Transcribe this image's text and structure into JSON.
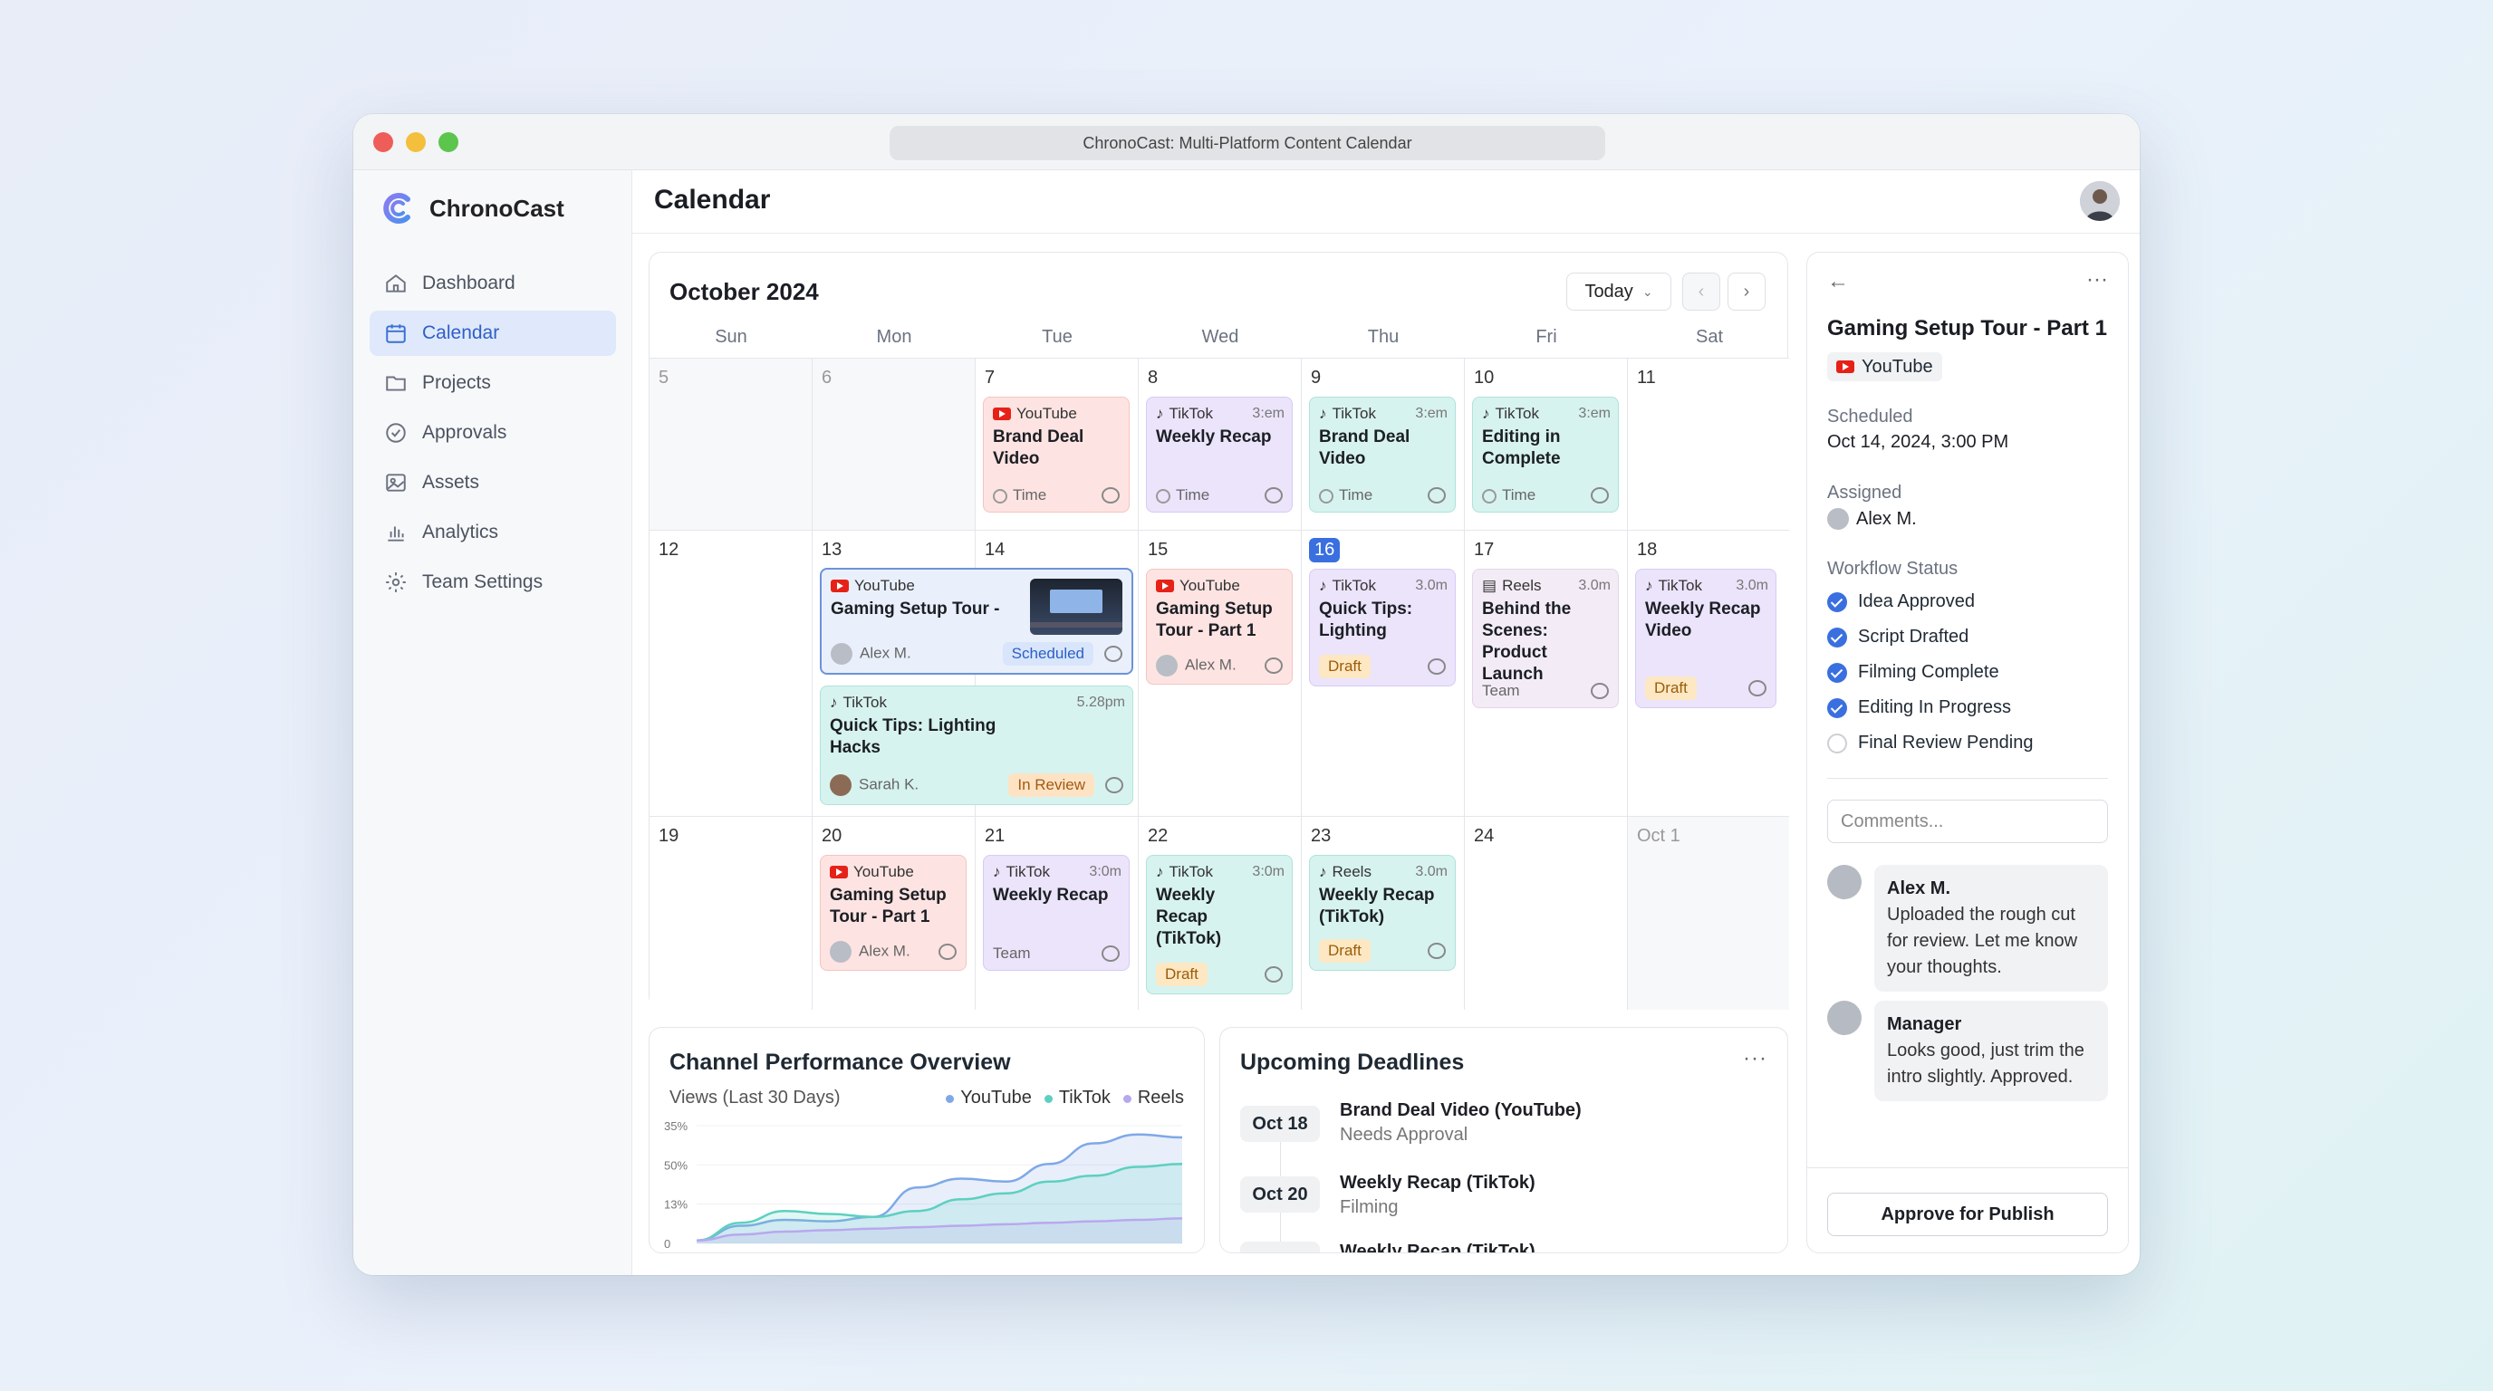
{
  "window": {
    "title": "ChronoCast: Multi-Platform Content Calendar"
  },
  "brand": {
    "name": "ChronoCast"
  },
  "sidebar": {
    "items": [
      {
        "label": "Dashboard",
        "icon": "home-icon"
      },
      {
        "label": "Calendar",
        "icon": "calendar-icon",
        "active": true
      },
      {
        "label": "Projects",
        "icon": "folder-icon"
      },
      {
        "label": "Approvals",
        "icon": "check-circle-icon"
      },
      {
        "label": "Assets",
        "icon": "image-icon"
      },
      {
        "label": "Analytics",
        "icon": "bar-chart-icon"
      },
      {
        "label": "Team Settings",
        "icon": "gear-icon"
      }
    ]
  },
  "header": {
    "title": "Calendar"
  },
  "calendar": {
    "month": "October 2024",
    "today_label": "Today",
    "weekdays": [
      "Sun",
      "Mon",
      "Tue",
      "Wed",
      "Thu",
      "Fri",
      "Sat"
    ],
    "days": [
      "5",
      "6",
      "7",
      "8",
      "9",
      "10",
      "11",
      "12",
      "13",
      "14",
      "15",
      "16",
      "17",
      "18",
      "19",
      "20",
      "21",
      "22",
      "23",
      "24",
      "Oct 1"
    ],
    "events": {
      "e7": {
        "platform": "YouTube",
        "title": "Brand Deal Video",
        "footer": "Time"
      },
      "e8": {
        "platform": "TikTok",
        "dur": "3:em",
        "title": "Weekly Recap",
        "footer": "Time"
      },
      "e9": {
        "platform": "TikTok",
        "dur": "3:em",
        "title": "Brand Deal Video",
        "footer": "Time"
      },
      "e10": {
        "platform": "TikTok",
        "dur": "3:em",
        "title": "Editing in Complete",
        "footer": "Time"
      },
      "e13a": {
        "platform": "YouTube",
        "title": "Gaming Setup Tour -",
        "user": "Alex M.",
        "badge": "Scheduled"
      },
      "e13b": {
        "platform": "TikTok",
        "time": "5.28pm",
        "title": "Quick Tips: Lighting Hacks",
        "user": "Sarah K.",
        "badge": "In Review"
      },
      "e15": {
        "platform": "YouTube",
        "title": "Gaming Setup Tour - Part 1",
        "user": "Alex M."
      },
      "e16": {
        "platform": "TikTok",
        "dur": "3.0m",
        "title": "Quick Tips: Lighting",
        "badge": "Draft"
      },
      "e17": {
        "platform": "Reels",
        "dur": "3.0m",
        "title": "Behind the Scenes: Product Launch",
        "footer": "Team"
      },
      "e18": {
        "platform": "TikTok",
        "dur": "3.0m",
        "title": "Weekly Recap Video",
        "badge": "Draft"
      },
      "e20": {
        "platform": "YouTube",
        "title": "Gaming Setup Tour - Part 1",
        "user": "Alex M."
      },
      "e21": {
        "platform": "TikTok",
        "dur": "3:0m",
        "title": "Weekly Recap",
        "footer": "Team"
      },
      "e22": {
        "platform": "TikTok",
        "dur": "3:0m",
        "title": "Weekly Recap (TikTok)",
        "badge": "Draft"
      },
      "e23": {
        "platform": "Reels",
        "dur": "3.0m",
        "title": "Weekly Recap (TikTok)",
        "badge": "Draft"
      }
    }
  },
  "performance": {
    "title": "Channel Performance Overview",
    "subtitle": "Views (Last 30 Days)",
    "legend": [
      {
        "name": "YouTube",
        "color": "#7fa8e8"
      },
      {
        "name": "TikTok",
        "color": "#5dd0c0"
      },
      {
        "name": "Reels",
        "color": "#b8a8ee"
      }
    ],
    "y_ticks": [
      "35%",
      "50%",
      "13%",
      "0"
    ]
  },
  "chart_data": {
    "type": "area",
    "title": "Channel Performance Overview",
    "subtitle": "Views (Last 30 Days)",
    "y_ticks": [
      "35%",
      "50%",
      "13%",
      "0"
    ],
    "series": [
      {
        "name": "YouTube",
        "values": [
          2,
          12,
          16,
          15,
          18,
          38,
          44,
          42,
          54,
          68,
          74,
          72
        ]
      },
      {
        "name": "TikTok",
        "values": [
          2,
          14,
          22,
          20,
          18,
          22,
          30,
          34,
          42,
          46,
          52,
          54
        ]
      },
      {
        "name": "Reels",
        "values": [
          2,
          6,
          8,
          9,
          10,
          11,
          12,
          13,
          14,
          15,
          16,
          17
        ]
      }
    ],
    "ylim": [
      0,
      80
    ]
  },
  "deadlines": {
    "title": "Upcoming Deadlines",
    "items": [
      {
        "date": "Oct 18",
        "title": "Brand Deal Video (YouTube)",
        "status": "Needs Approval"
      },
      {
        "date": "Oct 20",
        "title": "Weekly Recap (TikTok)",
        "status": "Filming"
      },
      {
        "date": "",
        "title": "Weekly Recap (TikTok)",
        "status": ""
      }
    ]
  },
  "detail": {
    "title": "Gaming Setup Tour - Part 1",
    "platform": "YouTube",
    "scheduled_label": "Scheduled",
    "scheduled": "Oct 14, 2024, 3:00 PM",
    "assigned_label": "Assigned",
    "assigned": "Alex M.",
    "workflow_label": "Workflow Status",
    "workflow": [
      {
        "label": "Idea Approved",
        "done": true
      },
      {
        "label": "Script Drafted",
        "done": true
      },
      {
        "label": "Filming Complete",
        "done": true
      },
      {
        "label": "Editing In Progress",
        "done": true
      },
      {
        "label": "Final Review Pending",
        "done": false
      }
    ],
    "comment_placeholder": "Comments...",
    "comments": [
      {
        "author": "Alex M.",
        "text": "Uploaded the rough cut for review. Let me know your thoughts."
      },
      {
        "author": "Manager",
        "text": "Looks good, just trim the intro slightly. Approved."
      }
    ],
    "approve_label": "Approve for Publish"
  }
}
